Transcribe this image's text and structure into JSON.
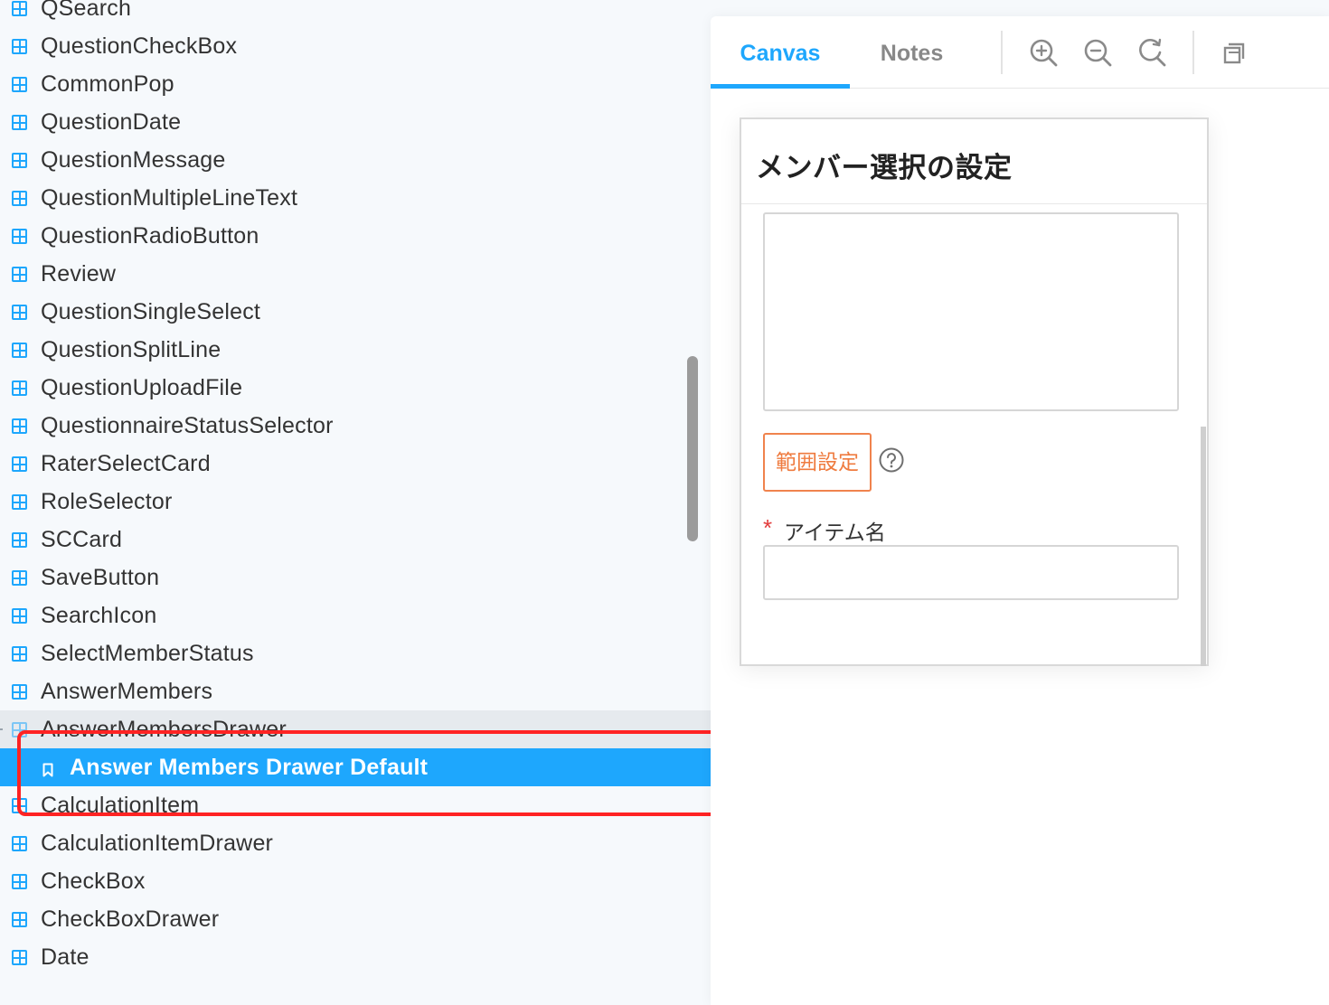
{
  "sidebar": {
    "items": [
      {
        "label": "QSearch",
        "kind": "component"
      },
      {
        "label": "QuestionCheckBox",
        "kind": "component"
      },
      {
        "label": "CommonPop",
        "kind": "component"
      },
      {
        "label": "QuestionDate",
        "kind": "component"
      },
      {
        "label": "QuestionMessage",
        "kind": "component"
      },
      {
        "label": "QuestionMultipleLineText",
        "kind": "component"
      },
      {
        "label": "QuestionRadioButton",
        "kind": "component"
      },
      {
        "label": "Review",
        "kind": "component"
      },
      {
        "label": "QuestionSingleSelect",
        "kind": "component"
      },
      {
        "label": "QuestionSplitLine",
        "kind": "component"
      },
      {
        "label": "QuestionUploadFile",
        "kind": "component"
      },
      {
        "label": "QuestionnaireStatusSelector",
        "kind": "component"
      },
      {
        "label": "RaterSelectCard",
        "kind": "component"
      },
      {
        "label": "RoleSelector",
        "kind": "component"
      },
      {
        "label": "SCCard",
        "kind": "component"
      },
      {
        "label": "SaveButton",
        "kind": "component"
      },
      {
        "label": "SearchIcon",
        "kind": "component"
      },
      {
        "label": "SelectMemberStatus",
        "kind": "component"
      },
      {
        "label": "AnswerMembers",
        "kind": "component"
      },
      {
        "label": "AnswerMembersDrawer",
        "kind": "component",
        "expanded": true
      },
      {
        "label": "Answer Members Drawer Default",
        "kind": "story",
        "selected": true
      },
      {
        "label": "CalculationItem",
        "kind": "component"
      },
      {
        "label": "CalculationItemDrawer",
        "kind": "component"
      },
      {
        "label": "CheckBox",
        "kind": "component"
      },
      {
        "label": "CheckBoxDrawer",
        "kind": "component"
      },
      {
        "label": "Date",
        "kind": "component"
      }
    ]
  },
  "toolbar": {
    "tabs": [
      {
        "label": "Canvas",
        "active": true
      },
      {
        "label": "Notes",
        "active": false
      }
    ],
    "icons": [
      "zoom-in-icon",
      "zoom-out-icon",
      "reset-zoom-icon",
      "layout-icon"
    ]
  },
  "drawer": {
    "title": "メンバー選択の設定",
    "range_button": "範囲設定",
    "help_icon": "question-circle-icon",
    "item_name_label": "アイテム名",
    "required_mark": "*",
    "item_name_value": ""
  },
  "colors": {
    "accent": "#1ea7fd",
    "orange": "#ef7b3f",
    "required": "#e23b3b",
    "annotation": "#ff2323"
  }
}
